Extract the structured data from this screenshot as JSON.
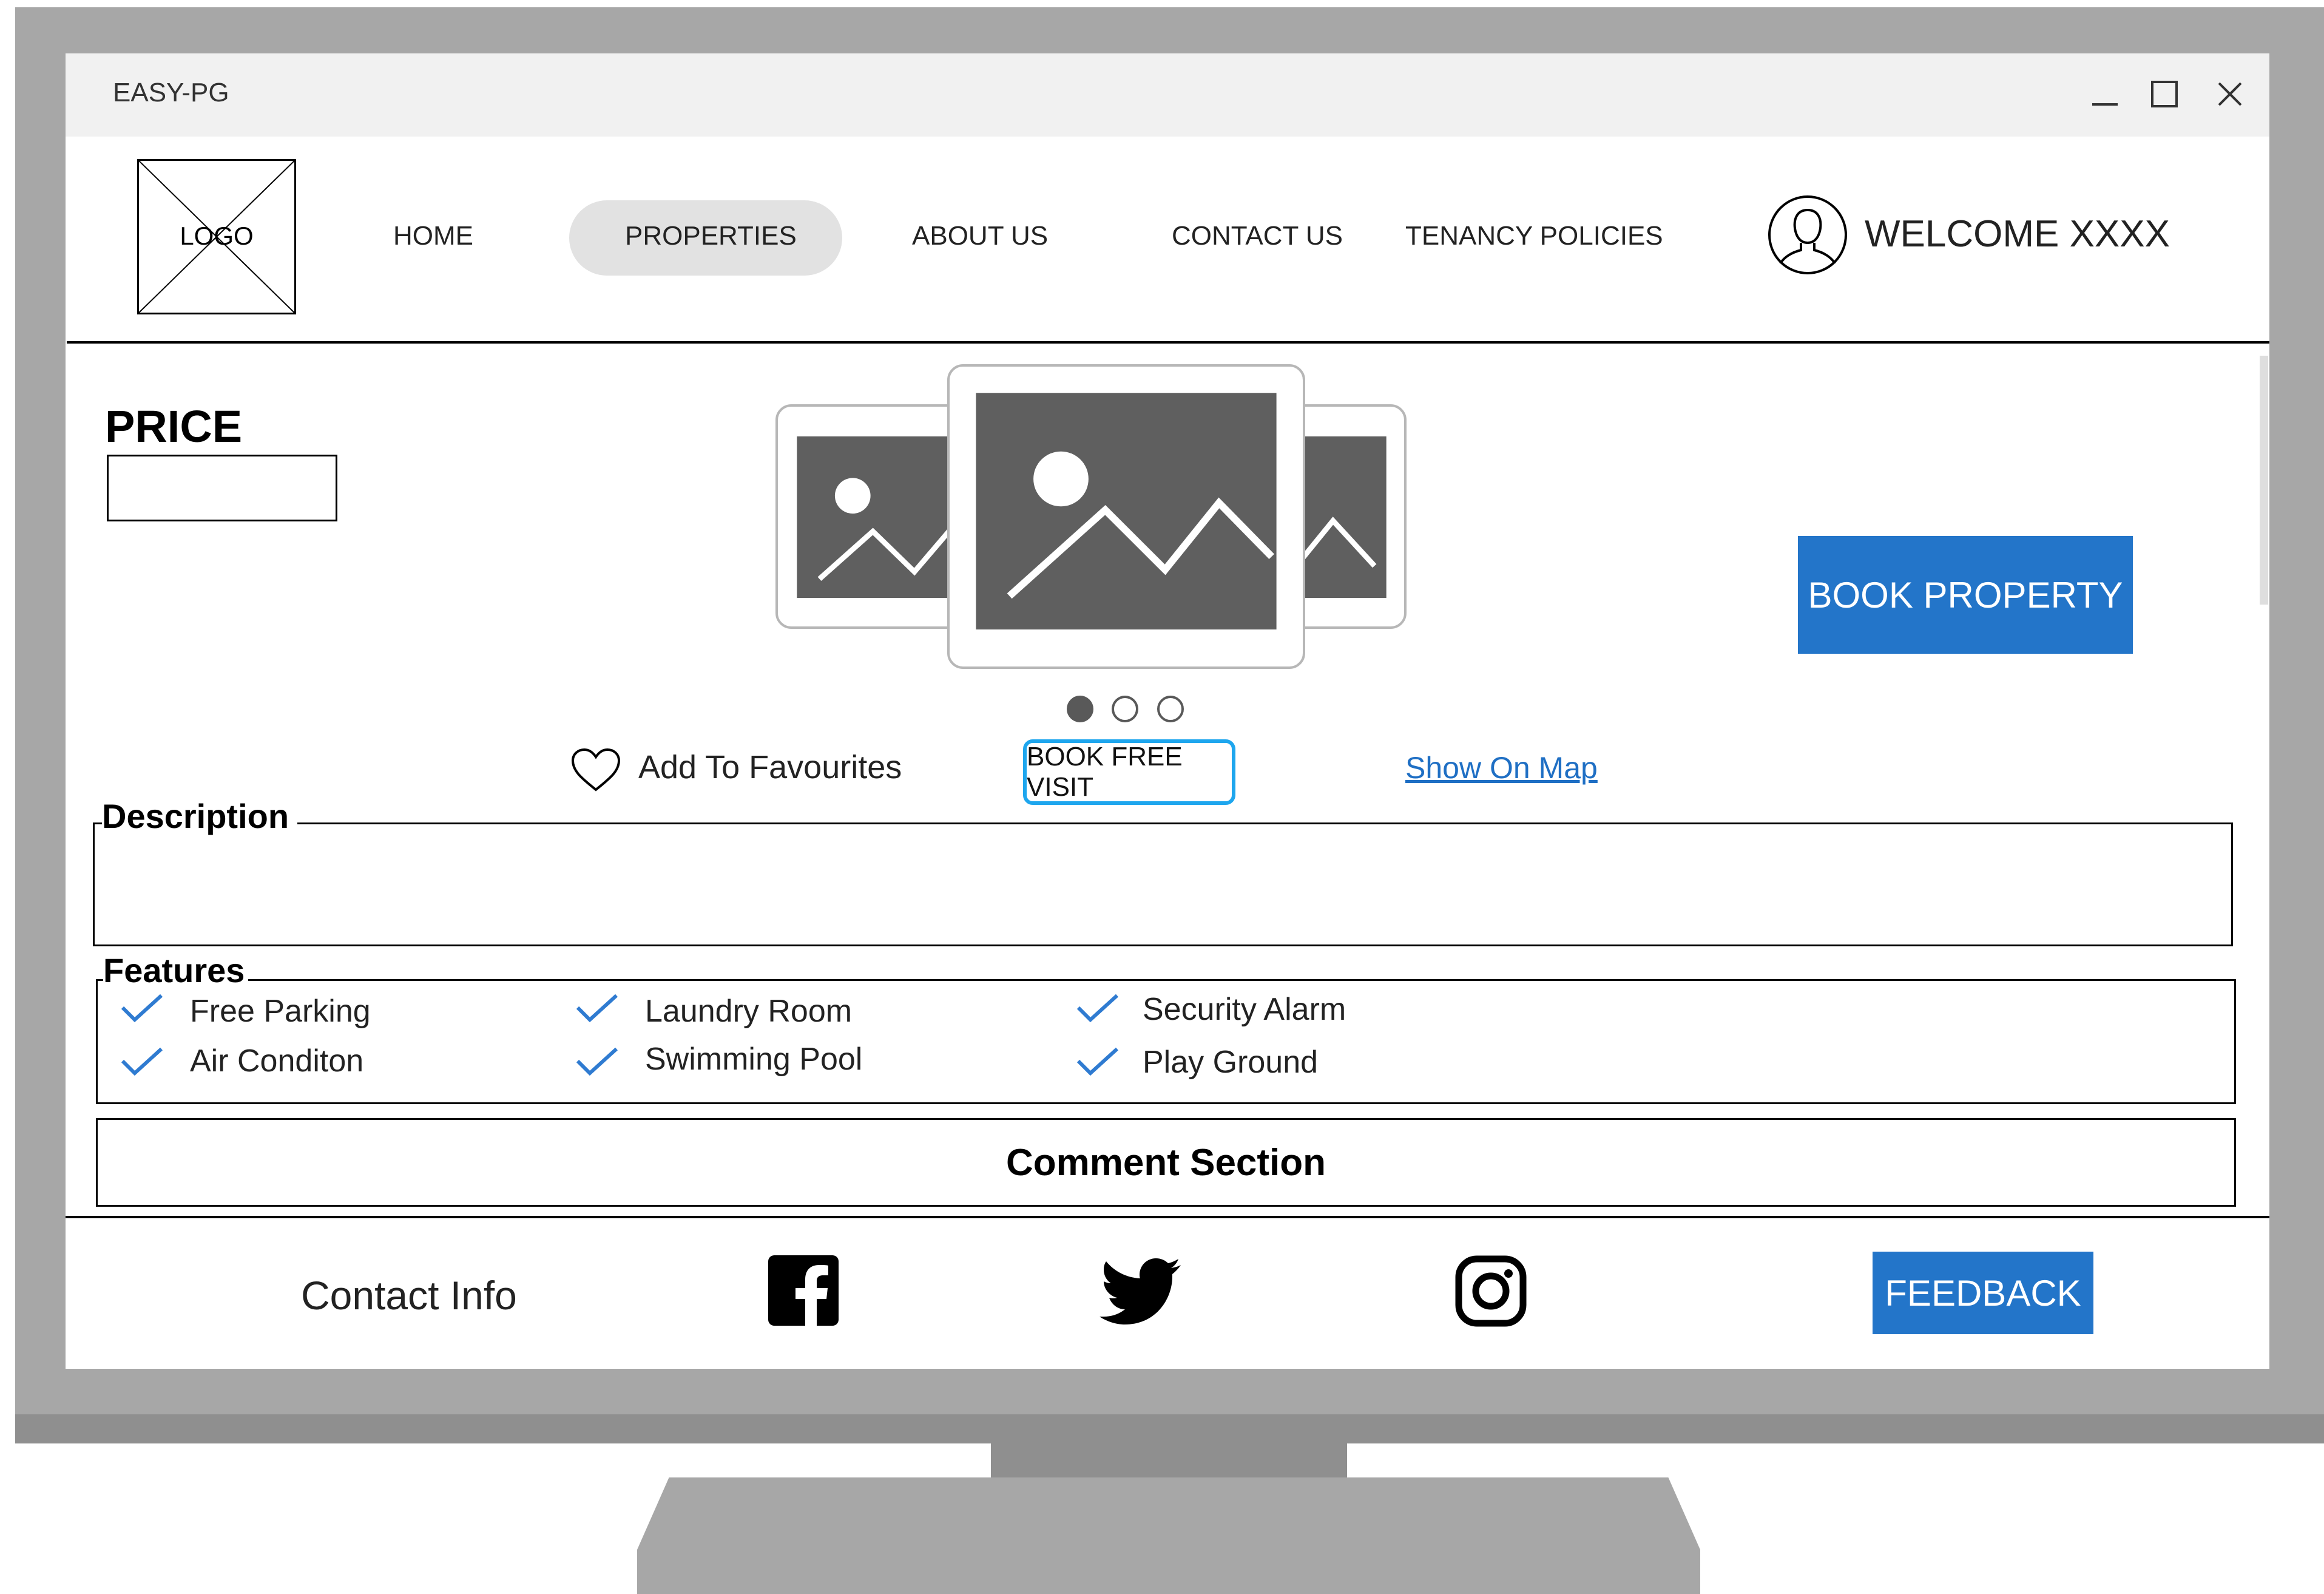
{
  "window": {
    "title": "EASY-PG",
    "controls": {
      "minimize": "minimize-icon",
      "maximize": "maximize-icon",
      "close": "close-icon"
    }
  },
  "header": {
    "logo_label": "LOGO",
    "nav": [
      {
        "label": "HOME",
        "active": false
      },
      {
        "label": "PROPERTIES",
        "active": true
      },
      {
        "label": "ABOUT US",
        "active": false
      },
      {
        "label": "CONTACT US",
        "active": false
      },
      {
        "label": "TENANCY POLICIES",
        "active": false
      }
    ],
    "welcome": "WELCOME XXXX",
    "user_icon": "user-avatar-icon"
  },
  "property": {
    "price_label": "PRICE",
    "price_value": "",
    "carousel": {
      "image_icon": "image-placeholder-icon",
      "slide_count": 3,
      "active_slide": 1
    },
    "book_property_label": "BOOK PROPERTY",
    "add_favourites_label": "Add To Favourites",
    "book_free_visit_label": "BOOK FREE VISIT",
    "show_on_map_label": "Show On Map",
    "description_label": "Description",
    "description_text": "",
    "features_label": "Features",
    "features": [
      {
        "label": "Free Parking",
        "checked": true
      },
      {
        "label": "Laundry Room",
        "checked": true
      },
      {
        "label": "Security Alarm",
        "checked": true
      },
      {
        "label": "Air Conditon",
        "checked": true
      },
      {
        "label": "Swimming Pool",
        "checked": true
      },
      {
        "label": "Play Ground",
        "checked": true
      }
    ],
    "comment_section_label": "Comment Section"
  },
  "footer": {
    "contact_info": "Contact Info",
    "social_icons": [
      "facebook-icon",
      "twitter-icon",
      "instagram-icon"
    ],
    "feedback_label": "FEEDBACK"
  },
  "colors": {
    "primary_button": "#2375c9",
    "visit_button_border": "#1ea6ee",
    "link": "#1f6fc4",
    "check": "#2f7bd1",
    "nav_active_pill": "#e2e2e2",
    "monitor": "#a7a7a7"
  }
}
